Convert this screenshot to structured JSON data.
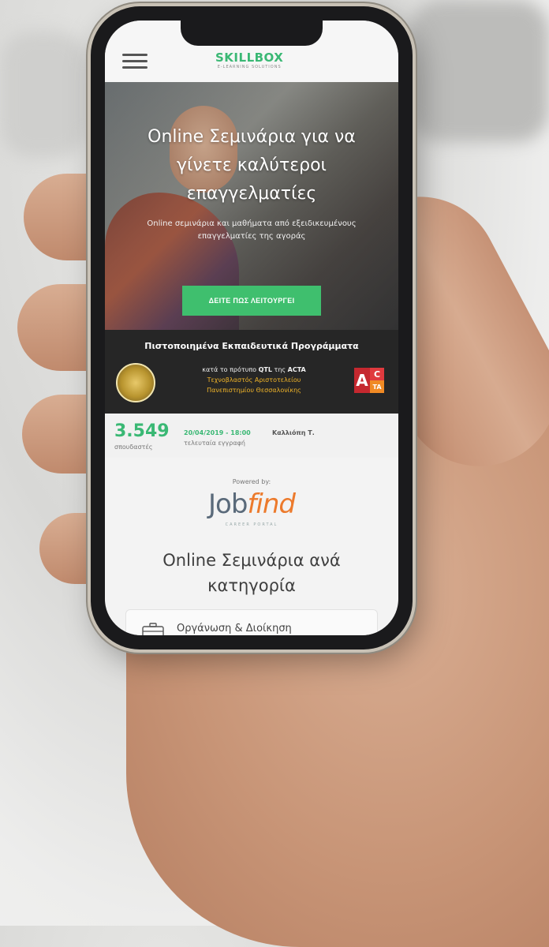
{
  "header": {
    "logo_main": "SKILLBOX",
    "logo_sub": "E-LEARNING SOLUTIONS"
  },
  "hero": {
    "title": "Online Σεμινάρια για να γίνετε καλύτεροι επαγγελματίες",
    "subtitle": "Online σεμινάρια και μαθήματα από εξειδικευμένους επαγγελματίες της αγοράς",
    "cta_label": "ΔΕΙΤΕ ΠΩΣ ΛΕΙΤΟΥΡΓΕΙ"
  },
  "accreditation": {
    "title": "Πιστοποιημένα Εκπαιδευτικά Προγράμματα",
    "line1_prefix": "κατά το πρότυπο",
    "line1_qtl": "QTL",
    "line1_mid": "της",
    "line1_acta": "ACTA",
    "line2": "Τεχνοβλαστός Αριστοτελείου",
    "line3": "Πανεπιστημίου Θεσσαλονίκης",
    "acta_a": "A",
    "acta_c": "C",
    "acta_ta": "TA"
  },
  "stats": {
    "count": "3.549",
    "count_label": "σπουδαστές",
    "last_date": "20/04/2019 - 18:00",
    "last_name": "Καλλιόπη Τ.",
    "last_label": "τελευταία εγγραφή"
  },
  "partner": {
    "powered_by": "Powered by:",
    "brand_job": "Job",
    "brand_find": "find",
    "brand_sub": "CAREER PORTAL"
  },
  "categories": {
    "heading": "Online Σεμινάρια ανά κατηγορία",
    "items": [
      {
        "label": "Οργάνωση & Διοίκηση",
        "icon": "briefcase-icon"
      }
    ]
  },
  "colors": {
    "accent": "#3ab874",
    "cta": "#3fbf6e",
    "band": "#262626",
    "highlight": "#f0b429",
    "brand_orange": "#ec7a2c"
  }
}
